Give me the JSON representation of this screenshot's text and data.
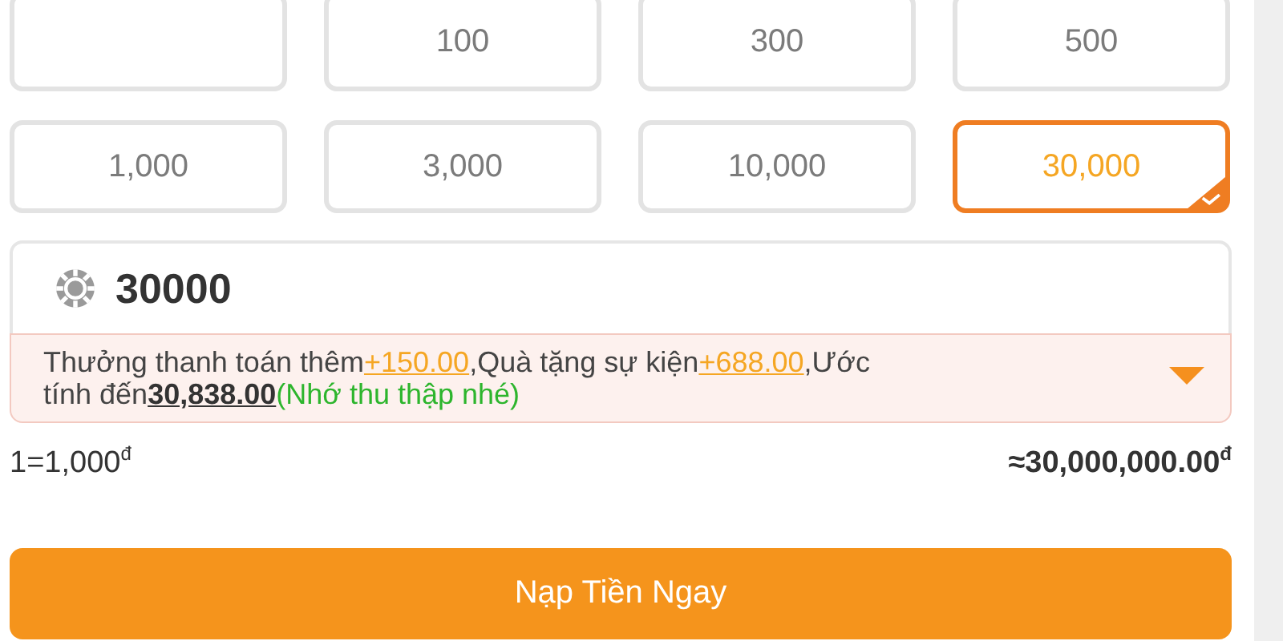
{
  "amounts": [
    {
      "selected": false
    },
    {
      "label": "100",
      "selected": false
    },
    {
      "label": "300",
      "selected": false
    },
    {
      "label": "500",
      "selected": false
    },
    {
      "label": "1,000",
      "selected": false
    },
    {
      "label": "3,000",
      "selected": false
    },
    {
      "label": "10,000",
      "selected": false
    },
    {
      "label": "30,000",
      "selected": true
    }
  ],
  "amount_field": {
    "value": "30000"
  },
  "notice": {
    "segments": [
      {
        "kind": "plain",
        "text": "Thưởng thanh toán thêm"
      },
      {
        "kind": "bonus",
        "text": "+150.00"
      },
      {
        "kind": "plain",
        "text": ",Quà tặng sự kiện"
      },
      {
        "kind": "bonus",
        "text": "+688.00"
      },
      {
        "kind": "plain",
        "text": ",Ước tính đến"
      },
      {
        "kind": "total",
        "text": "30,838.00"
      },
      {
        "kind": "hint",
        "text": "(Nhớ thu thập nhé)"
      }
    ],
    "expanded": false
  },
  "rate": "1=1,000$^{đ}$",
  "converted": "≈30,000,000.00$^{đ}$",
  "submit": "Nạp Tiền Ngay"
}
